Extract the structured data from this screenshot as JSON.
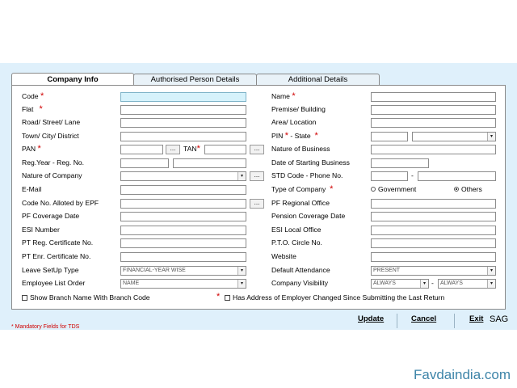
{
  "tabs": [
    {
      "label": "Company Info",
      "active": true
    },
    {
      "label": "Authorised Person Details",
      "active": false
    },
    {
      "label": "Additional Details",
      "active": false
    }
  ],
  "left_labels": {
    "code": "Code",
    "flat": "Flat",
    "road": "Road/ Street/ Lane",
    "town": "Town/ City/ District",
    "pan": "PAN",
    "tan": "TAN",
    "reg_year": "Reg.Year - Reg. No.",
    "nature_company": "Nature of Company",
    "email": "E-Mail",
    "code_epf": "Code No. Alloted by EPF",
    "pf_coverage": "PF Coverage Date",
    "esi_number": "ESI Number",
    "pt_reg": "PT Reg. Certificate No.",
    "pt_enr": "PT Enr. Certificate No.",
    "leave_setup": "Leave SetUp Type",
    "emp_list_order": "Employee List Order"
  },
  "right_labels": {
    "name": "Name",
    "premise": "Premise/ Building",
    "area": "Area/ Location",
    "pin": "PIN",
    "state": "- State",
    "nature_business": "Nature of Business",
    "date_start": "Date of Starting Business",
    "std_code": "STD Code - Phone No.",
    "type_company": "Type of Company",
    "pf_regional": "PF Regional Office",
    "pension_date": "Pension Coverage Date",
    "esi_local": "ESI Local Office",
    "pto_circle": "P.T.O. Circle No.",
    "website": "Website",
    "default_attendance": "Default Attendance",
    "company_visibility": "Company Visibility"
  },
  "required_mark": "*",
  "ellipsis": "...",
  "dash": "-",
  "selects": {
    "leave_setup": "FINANCIAL-YEAR WISE",
    "emp_list_order": "NAME",
    "default_attendance": "PRESENT",
    "visibility_from": "ALWAYS",
    "visibility_to": "ALWAYS",
    "arrow": "▾"
  },
  "radios": {
    "government": "Government",
    "others": "Others",
    "selected": "others"
  },
  "checkboxes": {
    "show_branch": "Show Branch Name With Branch Code",
    "address_changed": "Has Address of Employer Changed Since Submitting the Last Return"
  },
  "footer_note": "* Mandatory Fields for TDS",
  "buttons": {
    "update": "Update",
    "cancel": "Cancel",
    "exit": "Exit"
  },
  "brand": "SAG",
  "watermark": "Favdaindia.com"
}
